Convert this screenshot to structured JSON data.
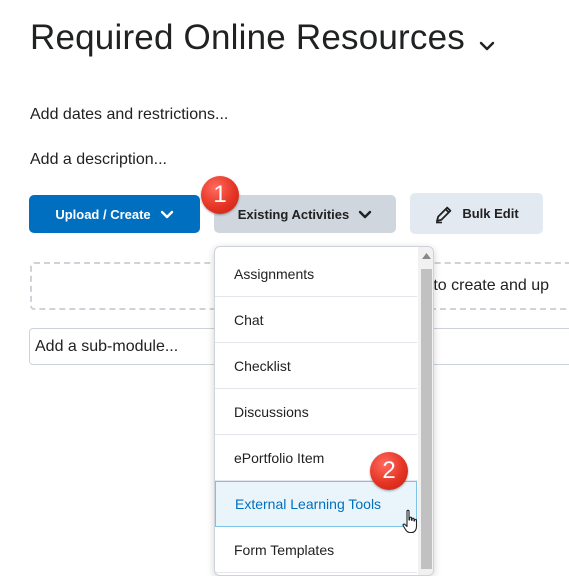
{
  "page": {
    "title": "Required Online Resources",
    "add_dates": "Add dates and restrictions...",
    "add_description": "Add a description..."
  },
  "toolbar": {
    "upload_create": "Upload / Create",
    "existing_activities": "Existing Activities",
    "bulk_edit": "Bulk Edit"
  },
  "dropzone": {
    "text": "e to create and up"
  },
  "submodule": {
    "placeholder": "Add a sub-module..."
  },
  "menu": {
    "items": [
      {
        "label": "Assignments"
      },
      {
        "label": "Chat"
      },
      {
        "label": "Checklist"
      },
      {
        "label": "Discussions"
      },
      {
        "label": "ePortfolio Item"
      },
      {
        "label": "External Learning Tools"
      },
      {
        "label": "Form Templates"
      }
    ]
  },
  "callouts": {
    "step1": "1",
    "step2": "2"
  },
  "colors": {
    "primary": "#006fbf",
    "secondary": "#cfd6dd",
    "badge": "#e53424",
    "active_item_bg": "#e9f5fb"
  },
  "icons": {
    "title_chevron": "chevron-down-icon",
    "button_chevron": "chevron-down-icon",
    "bulk_edit": "pencil-icon",
    "cursor": "hand-pointer-icon"
  }
}
